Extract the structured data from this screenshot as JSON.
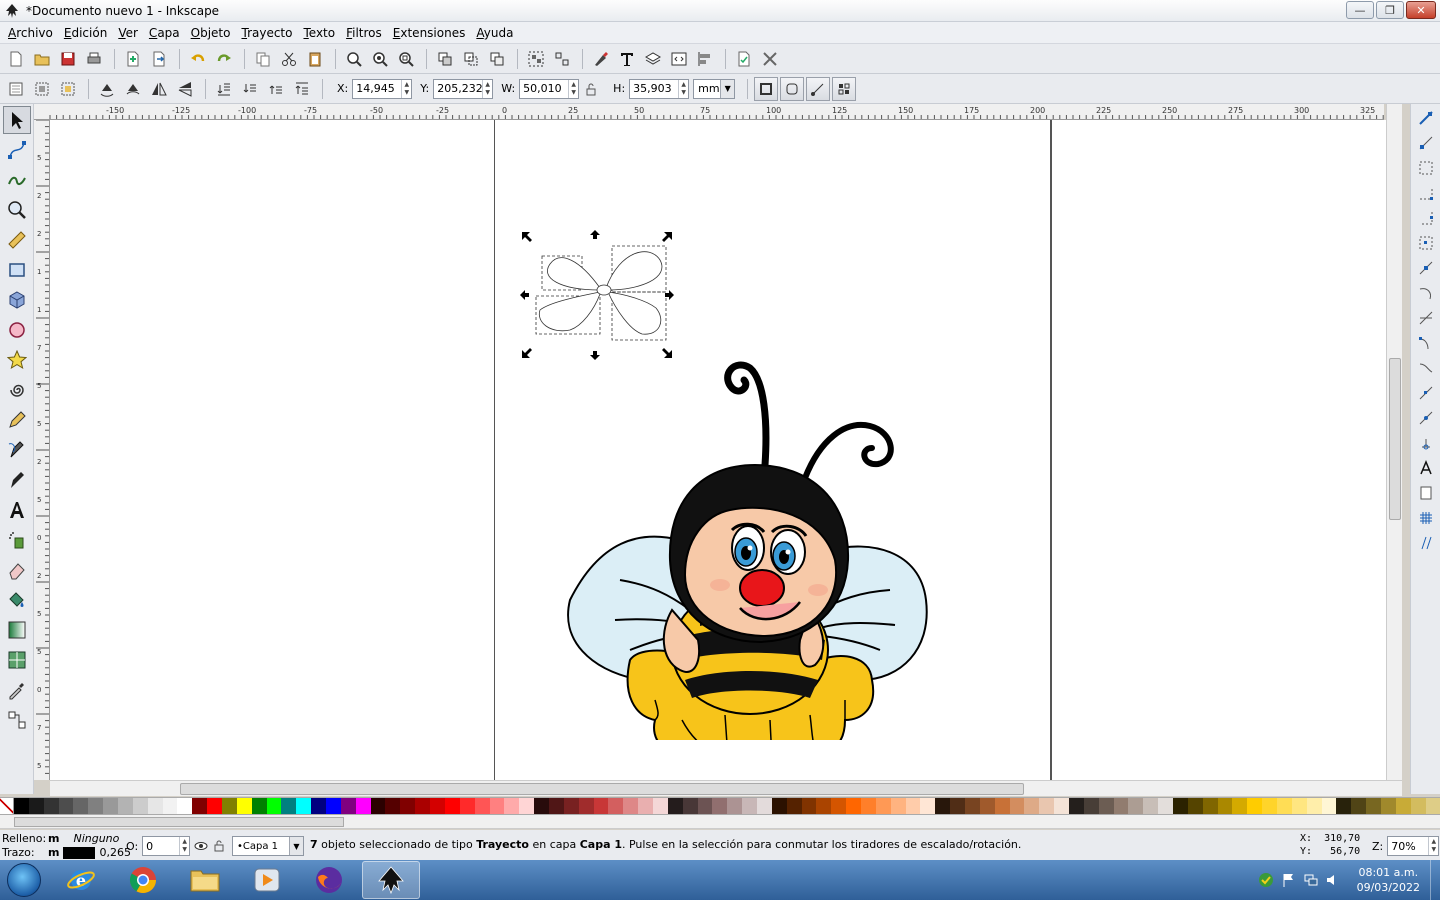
{
  "window": {
    "title": "*Documento nuevo 1 - Inkscape",
    "minimize": "—",
    "maximize": "❐",
    "close": "✕"
  },
  "menu": [
    "Archivo",
    "Edición",
    "Ver",
    "Capa",
    "Objeto",
    "Trayecto",
    "Texto",
    "Filtros",
    "Extensiones",
    "Ayuda"
  ],
  "controls": {
    "x_label": "X:",
    "x_value": "14,945",
    "y_label": "Y:",
    "y_value": "205,232",
    "w_label": "W:",
    "w_value": "50,010",
    "h_label": "H:",
    "h_value": "35,903",
    "unit": "mm"
  },
  "ruler_top": [
    "-150",
    "-125",
    "-100",
    "-75",
    "-50",
    "-25",
    "0",
    "25",
    "50",
    "75",
    "100",
    "125",
    "150",
    "175",
    "200",
    "225",
    "250",
    "275",
    "300",
    "325"
  ],
  "ruler_left": [
    "5",
    "2",
    "2",
    "1",
    "1",
    "7",
    "5",
    "5",
    "2",
    "5",
    "0",
    "2",
    "5",
    "5",
    "0",
    "7",
    "5"
  ],
  "statusbar": {
    "fill_label": "Relleno:",
    "fill_m": "m",
    "fill_value": "Ninguno",
    "stroke_label": "Trazo:",
    "stroke_m": "m",
    "stroke_width": "0,265",
    "opacity_label": "O:",
    "opacity_value": "0",
    "layer": "•Capa 1",
    "message_count": "7",
    "message_a": " objeto seleccionado de tipo ",
    "message_type": "Trayecto",
    "message_b": " en capa ",
    "message_layer": "Capa 1",
    "message_c": ". Pulse en la selección para conmutar los tiradores de escalado/rotación.",
    "coord_x": "X:  310,70",
    "coord_y": "Y:   56,70",
    "zoom_label": "Z:",
    "zoom_value": "70%"
  },
  "taskbar": {
    "time": "08:01 a.m.",
    "date": "09/03/2022"
  },
  "palette": [
    "#000000",
    "#1a1a1a",
    "#333333",
    "#4d4d4d",
    "#666666",
    "#808080",
    "#999999",
    "#b3b3b3",
    "#cccccc",
    "#e6e6e6",
    "#f2f2f2",
    "#ffffff",
    "#800000",
    "#ff0000",
    "#808000",
    "#ffff00",
    "#008000",
    "#00ff00",
    "#008080",
    "#00ffff",
    "#000080",
    "#0000ff",
    "#800080",
    "#ff00ff",
    "#2b0000",
    "#550000",
    "#800000",
    "#aa0000",
    "#d40000",
    "#ff0000",
    "#ff2a2a",
    "#ff5555",
    "#ff8080",
    "#ffaaaa",
    "#ffd5d5",
    "#280b0b",
    "#501616",
    "#782121",
    "#a02c2c",
    "#c83737",
    "#d35f5f",
    "#de8787",
    "#e9afaf",
    "#f4d7d7",
    "#241c1c",
    "#483737",
    "#6c5353",
    "#916f6f",
    "#ac9393",
    "#c8b7b7",
    "#e3dbdb",
    "#2b1100",
    "#552200",
    "#803300",
    "#aa4400",
    "#d45500",
    "#ff6600",
    "#ff7f2a",
    "#ff9955",
    "#ffb380",
    "#ffccaa",
    "#ffe6d5",
    "#28170b",
    "#502d16",
    "#784421",
    "#a05a2c",
    "#c87137",
    "#d38d5f",
    "#deaa87",
    "#e9c6af",
    "#f4e3d7",
    "#241f1c",
    "#483e37",
    "#6c5d53",
    "#917c6f",
    "#ac9d93",
    "#c8beb7",
    "#e3dedb",
    "#2b2200",
    "#554400",
    "#806600",
    "#aa8800",
    "#d4aa00",
    "#ffcc00",
    "#ffd42a",
    "#ffdd55",
    "#ffe680",
    "#ffeeaa",
    "#fff6d5",
    "#28220b",
    "#504416",
    "#786721",
    "#a0892c",
    "#c8ab37",
    "#d3bc5f",
    "#decd87"
  ]
}
